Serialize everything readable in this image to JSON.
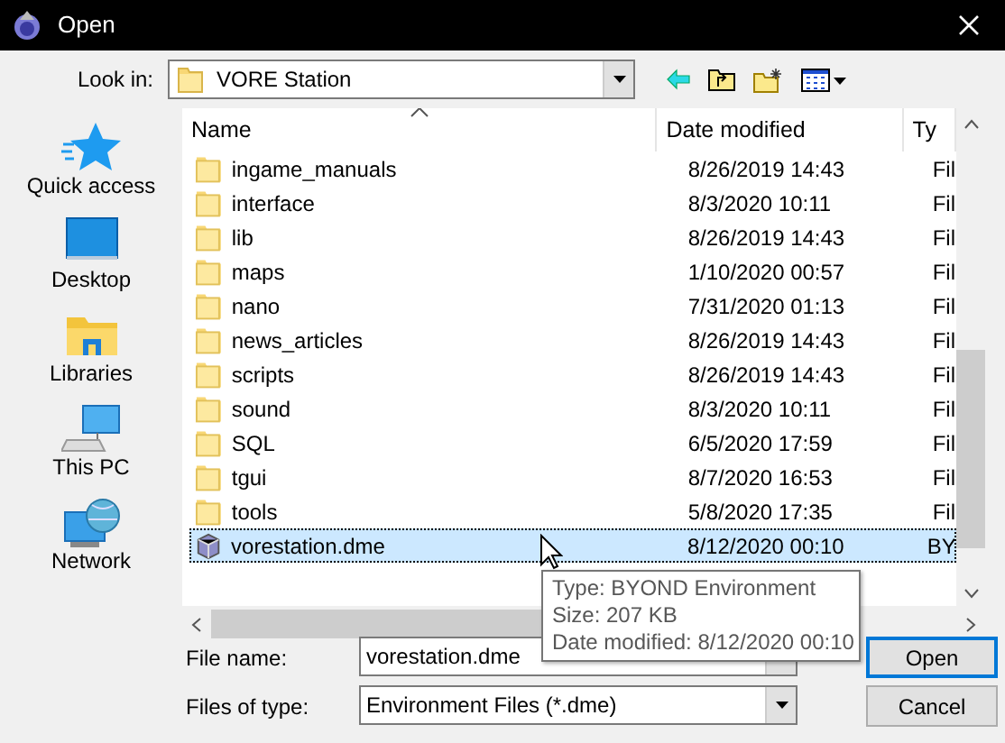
{
  "window": {
    "title": "Open"
  },
  "look_in": {
    "label": "Look in:",
    "value": "VORE Station"
  },
  "places": [
    {
      "kind": "star",
      "label": "Quick access"
    },
    {
      "kind": "desktop",
      "label": "Desktop"
    },
    {
      "kind": "libraries",
      "label": "Libraries"
    },
    {
      "kind": "pc",
      "label": "This PC"
    },
    {
      "kind": "network",
      "label": "Network"
    }
  ],
  "columns": [
    {
      "label": "Name",
      "sorted": true
    },
    {
      "label": "Date modified",
      "sorted": false
    },
    {
      "label": "Ty",
      "sorted": false
    }
  ],
  "files": [
    {
      "kind": "folder",
      "name": "ingame_manuals",
      "date": "8/26/2019 14:43",
      "type": "Fil",
      "selected": false
    },
    {
      "kind": "folder",
      "name": "interface",
      "date": "8/3/2020 10:11",
      "type": "Fil",
      "selected": false
    },
    {
      "kind": "folder",
      "name": "lib",
      "date": "8/26/2019 14:43",
      "type": "Fil",
      "selected": false
    },
    {
      "kind": "folder",
      "name": "maps",
      "date": "1/10/2020 00:57",
      "type": "Fil",
      "selected": false
    },
    {
      "kind": "folder",
      "name": "nano",
      "date": "7/31/2020 01:13",
      "type": "Fil",
      "selected": false
    },
    {
      "kind": "folder",
      "name": "news_articles",
      "date": "8/26/2019 14:43",
      "type": "Fil",
      "selected": false
    },
    {
      "kind": "folder",
      "name": "scripts",
      "date": "8/26/2019 14:43",
      "type": "Fil",
      "selected": false
    },
    {
      "kind": "folder",
      "name": "sound",
      "date": "8/3/2020 10:11",
      "type": "Fil",
      "selected": false
    },
    {
      "kind": "folder",
      "name": "SQL",
      "date": "6/5/2020 17:59",
      "type": "Fil",
      "selected": false
    },
    {
      "kind": "folder",
      "name": "tgui",
      "date": "8/7/2020 16:53",
      "type": "Fil",
      "selected": false
    },
    {
      "kind": "folder",
      "name": "tools",
      "date": "5/8/2020 17:35",
      "type": "Fil",
      "selected": false
    },
    {
      "kind": "file",
      "name": "vorestation.dme",
      "date": "8/12/2020 00:10",
      "type": "BY",
      "selected": true
    }
  ],
  "tooltip": [
    "Type: BYOND Environment",
    "Size: 207 KB",
    "Date modified: 8/12/2020 00:10"
  ],
  "file_name": {
    "label": "File name:",
    "value": "vorestation.dme"
  },
  "file_type": {
    "label": "Files of type:",
    "value": "Environment Files (*.dme)"
  },
  "buttons": [
    "Open",
    "Cancel"
  ]
}
